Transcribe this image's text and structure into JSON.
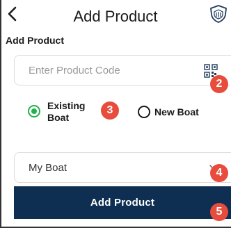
{
  "header": {
    "title": "Add Product",
    "back_icon": "chevron-left-icon",
    "logo_icon": "shield-logo-icon"
  },
  "form": {
    "section_title": "Add Product",
    "product_code": {
      "placeholder": "Enter Product Code",
      "scan_icon": "qr-code-icon"
    },
    "boat_type": {
      "options": [
        {
          "label": "Existing Boat",
          "selected": true
        },
        {
          "label": "New Boat",
          "selected": false
        }
      ]
    },
    "boat_select": {
      "value": "My Boat",
      "icon": "chevron-down-icon"
    },
    "submit_label": "Add Product"
  },
  "annotations": [
    "2",
    "3",
    "4",
    "5"
  ],
  "colors": {
    "accent_green": "#22b24c",
    "button_navy": "#0f2f52",
    "badge_red": "#e74c3c"
  }
}
